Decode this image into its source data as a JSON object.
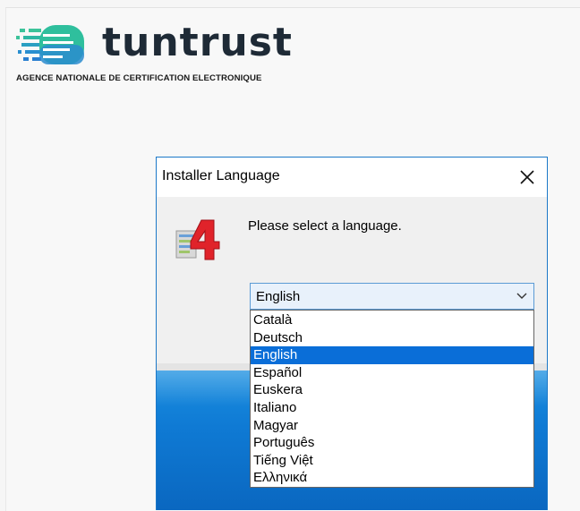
{
  "brand": {
    "name": "tuntrust",
    "tagline": "AGENCE NATIONALE DE CERTIFICATION ELECTRONIQUE",
    "colors": {
      "mark_green": "#3cc39a",
      "mark_blue": "#2a7fd0",
      "text": "#1e2a36"
    }
  },
  "dialog": {
    "title": "Installer Language",
    "close_icon": "close-icon",
    "prompt": "Please select a language.",
    "app_icon": "installer-app-icon",
    "combo": {
      "selected": "English"
    },
    "dropdown": {
      "items": [
        "Català",
        "Deutsch",
        "English",
        "Español",
        "Euskera",
        "Italiano",
        "Magyar",
        "Português",
        "Tiếng Việt",
        "Ελληνικά"
      ],
      "selected_index": 2
    },
    "colors": {
      "border": "#1c78c8",
      "highlight": "#0a6ed8",
      "background_blue": "#0f7ad4"
    }
  }
}
